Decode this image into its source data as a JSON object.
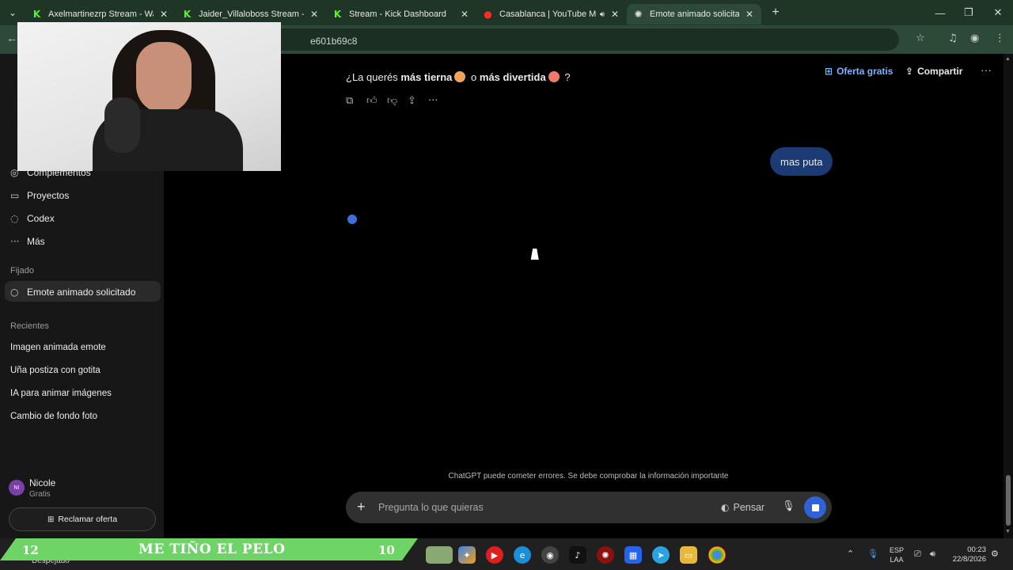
{
  "browser": {
    "tabs": [
      {
        "label": "Axelmartinezrp Stream - Watch",
        "favicon": "kick-icon",
        "glyph": "K",
        "color": "#53fc18",
        "audio": false
      },
      {
        "label": "Jaider_Villaloboss Stream - Wat",
        "favicon": "kick-icon",
        "glyph": "K",
        "color": "#53fc18",
        "audio": false
      },
      {
        "label": "Stream - Kick Dashboard",
        "favicon": "kick-icon",
        "glyph": "K",
        "color": "#53fc18",
        "audio": false
      },
      {
        "label": "Casablanca | YouTube Musi",
        "favicon": "youtube-music-icon",
        "glyph": "●",
        "color": "#ff2a2a",
        "audio": true
      },
      {
        "label": "Emote animado solicitado",
        "favicon": "chatgpt-icon",
        "glyph": "✺",
        "color": "#e0e0e0",
        "audio": false
      }
    ],
    "active_tab": 4,
    "url_fragment": "e601b69c8",
    "new_tab_label": "+"
  },
  "sidebar": {
    "items": [
      {
        "label": "Complementos",
        "icon": "plugin-icon",
        "glyph": "◎"
      },
      {
        "label": "Proyectos",
        "icon": "folder-icon",
        "glyph": "▭"
      },
      {
        "label": "Codex",
        "icon": "codex-icon",
        "glyph": "◌"
      },
      {
        "label": "Más",
        "icon": "more-dots-icon",
        "glyph": "···"
      }
    ],
    "pinned_heading": "Fijado",
    "pinned_item": "Emote animado solicitado",
    "recent_heading": "Recientes",
    "recent_items": [
      "Imagen animada emote",
      "Uña postiza con gotita",
      "IA para animar imágenes",
      "Cambio de fondo foto"
    ],
    "user": {
      "initials": "NI",
      "name": "Nicole",
      "plan": "Gratis"
    },
    "claim_offer_label": "Reclamar oferta"
  },
  "header": {
    "offer_label": "Oferta gratis",
    "share_label": "Compartir"
  },
  "conversation": {
    "assistant_prefix": "¿La querés ",
    "assistant_bold_1": "más tierna",
    "assistant_mid": " o ",
    "assistant_bold_2": "más divertida",
    "assistant_suffix": " ?",
    "user_message": "mas puta"
  },
  "composer": {
    "placeholder": "Pregunta lo que quieras",
    "think_label": "Pensar",
    "disclaimer": "ChatGPT puede cometer errores. Se debe comprobar la información importante"
  },
  "overlay_banner": {
    "left_number": "12",
    "title": "ME TIÑO EL PELO",
    "right_number": "10"
  },
  "taskbar": {
    "weather_text": "Despejado",
    "lang_line1": "ESP",
    "lang_line2": "LAA",
    "time": "00:23",
    "date": "22/8/2026"
  },
  "colors": {
    "accent_blue": "#2f62d6",
    "user_bubble": "#1c3a73",
    "tab_strip": "#1f3526",
    "banner_green": "#6fd466"
  }
}
